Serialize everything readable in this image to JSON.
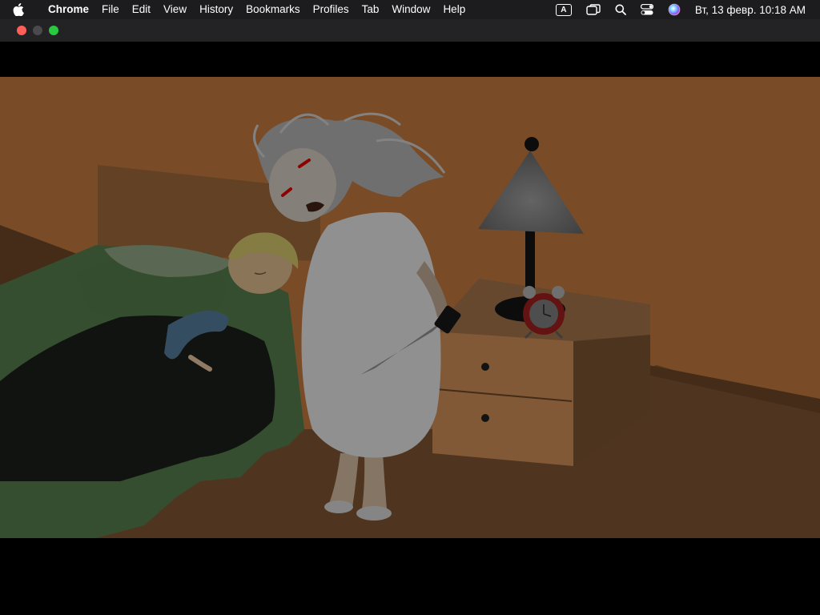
{
  "menubar": {
    "app_name": "Chrome",
    "items": [
      "File",
      "Edit",
      "View",
      "History",
      "Bookmarks",
      "Profiles",
      "Tab",
      "Window",
      "Help"
    ],
    "input_indicator": "A",
    "clock": "Вт, 13 февр.  10:18 AM"
  },
  "window": {
    "traffic_lights": {
      "close": "#ff5f57",
      "minimize": "#4a4a4c",
      "zoom": "#28c840"
    }
  },
  "scene": {
    "colors": {
      "wall": "#a86a36",
      "floor": "#6e4a2c",
      "blanket": "#4a6c42",
      "nightstand": "#b47c4c",
      "nightgown": "#c8c8c8"
    }
  }
}
